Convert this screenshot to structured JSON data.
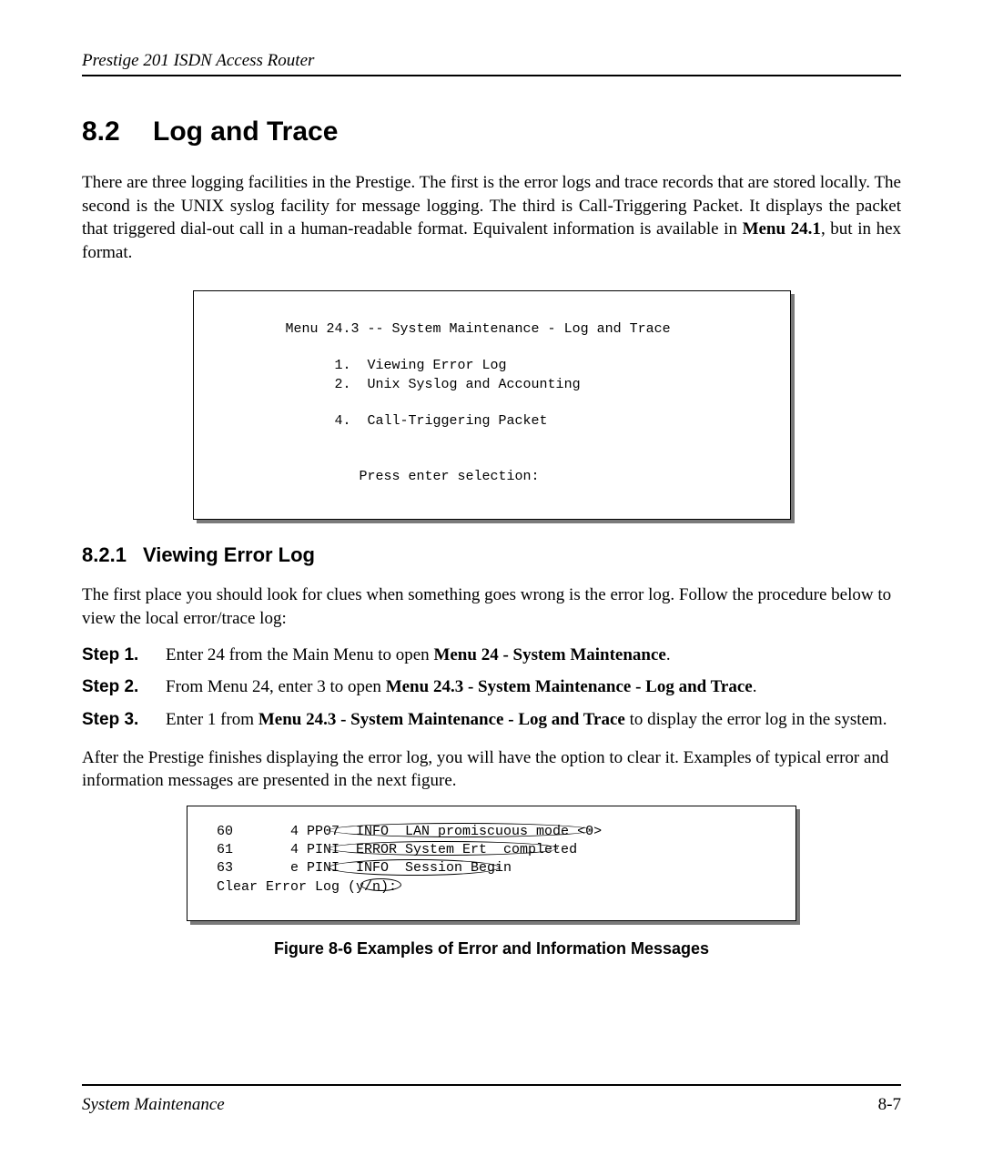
{
  "header": {
    "title": "Prestige 201 ISDN Access Router"
  },
  "section": {
    "number": "8.2",
    "title": "Log and Trace",
    "intro_pre": "There are three logging facilities in the Prestige.  The first is the error logs and trace records that are stored locally.  The second is the UNIX syslog facility for message logging. The third is Call-Triggering Packet. It displays the packet that triggered dial-out call in a human-readable format. Equivalent information is available in ",
    "intro_bold": "Menu 24.1",
    "intro_post": ", but in hex format."
  },
  "menu_box": {
    "line1": "         Menu 24.3 -- System Maintenance - Log and Trace",
    "line2": "               1.  Viewing Error Log",
    "line3": "               2.  Unix Syslog and Accounting",
    "line4": "",
    "line5": "               4.  Call-Triggering Packet",
    "line6": "",
    "line7": "",
    "line8": "                  Press enter selection:"
  },
  "subsection": {
    "number": "8.2.1",
    "title": "Viewing Error Log",
    "lead": "The first place you should look for clues when something goes wrong is the error log.  Follow the procedure below to view the local error/trace log:"
  },
  "steps": [
    {
      "label": "Step 1.",
      "pre": "Enter 24 from the Main Menu to open ",
      "bold": "Menu 24 - System Maintenance",
      "post": "."
    },
    {
      "label": "Step 2.",
      "pre": "From Menu 24, enter 3 to open ",
      "bold": "Menu 24.3 - System Maintenance - Log and Trace",
      "post": "."
    },
    {
      "label": "Step 3.",
      "pre": "Enter 1 from ",
      "bold": "Menu 24.3 - System Maintenance - Log and Trace",
      "post": " to display the error log in the system."
    }
  ],
  "after_steps": "After the Prestige finishes displaying the error log, you will have the option to clear it. Examples of typical error and information messages are presented in the next figure.",
  "errorlog": {
    "row1": "60       4 PP07  INFO  LAN promiscuous mode <0>",
    "row2": "61       4 PINI  ERROR System Ert  completed",
    "row3": "63       e PINI  INFO  Session Begin",
    "row4": "Clear Error Log (y/n):"
  },
  "figure_caption": "Figure 8-6 Examples of Error and Information Messages",
  "footer": {
    "left": "System Maintenance",
    "right": "8-7"
  }
}
